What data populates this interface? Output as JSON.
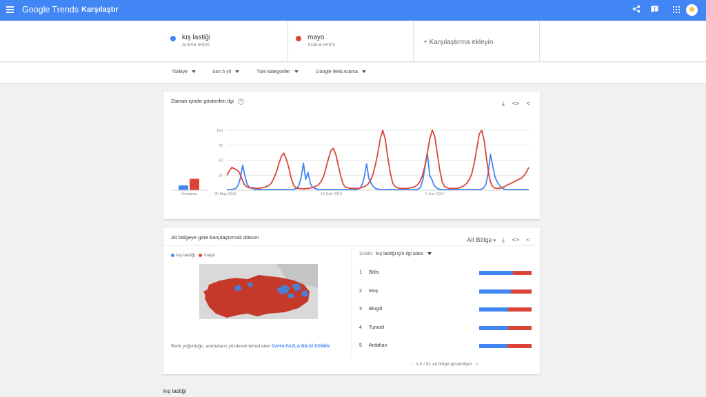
{
  "topbar": {
    "brand": "Google Trends",
    "page_name": "Karşılaştır",
    "icons": [
      "share-icon",
      "feedback-icon",
      "apps-icon",
      "avatar"
    ]
  },
  "terms": [
    {
      "name": "kış lastiği",
      "sub": "Arama terimi",
      "color": "#4285f4"
    },
    {
      "name": "mayo",
      "sub": "Arama terimi",
      "color": "#db4437"
    }
  ],
  "add_term_label": "+ Karşılaştırma ekleyin",
  "filters": [
    "Türkiye",
    "Son 5 yıl",
    "Tüm kategoriler",
    "Google Web Arama"
  ],
  "interest_card": {
    "title": "Zaman içinde gösterilen ilgi",
    "average_label": "Ortalama"
  },
  "chart_data": {
    "type": "line",
    "title": "",
    "y_ticks": [
      "100",
      "75",
      "50",
      "25"
    ],
    "ylim": [
      0,
      100
    ],
    "x_ticks": [
      "25 May 2014",
      "14 Şub 2016",
      "5 Kas 2017"
    ],
    "averages": [
      {
        "name": "kış lastiği",
        "value": 8
      },
      {
        "name": "mayo",
        "value": 19
      }
    ],
    "series": [
      {
        "name": "kış lastiği",
        "color": "#4285f4",
        "values": [
          1,
          1,
          1,
          2,
          3,
          8,
          20,
          42,
          25,
          10,
          5,
          3,
          2,
          1,
          1,
          1,
          1,
          1,
          1,
          1,
          1,
          1,
          1,
          1,
          1,
          1,
          1,
          1,
          1,
          1,
          2,
          3,
          8,
          22,
          45,
          18,
          30,
          12,
          5,
          3,
          2,
          1,
          1,
          1,
          1,
          1,
          1,
          1,
          1,
          1,
          1,
          1,
          1,
          1,
          1,
          1,
          1,
          1,
          2,
          3,
          9,
          22,
          44,
          20,
          12,
          6,
          3,
          2,
          1,
          1,
          1,
          1,
          1,
          1,
          1,
          1,
          1,
          1,
          1,
          1,
          1,
          1,
          1,
          1,
          1,
          2,
          5,
          18,
          40,
          62,
          25,
          18,
          8,
          4,
          2,
          1,
          1,
          1,
          1,
          1,
          1,
          1,
          1,
          1,
          1,
          1,
          1,
          1,
          1,
          1,
          1,
          1,
          1,
          2,
          4,
          10,
          30,
          60,
          40,
          22,
          14,
          8,
          4,
          2,
          1,
          1,
          1,
          1,
          1,
          1,
          1,
          1,
          1,
          1,
          1
        ]
      },
      {
        "name": "mayo",
        "color": "#db4437",
        "values": [
          25,
          32,
          38,
          36,
          34,
          30,
          20,
          10,
          6,
          4,
          4,
          4,
          3,
          3,
          4,
          5,
          6,
          8,
          12,
          20,
          30,
          44,
          56,
          62,
          52,
          38,
          20,
          8,
          4,
          3,
          3,
          2,
          3,
          3,
          4,
          5,
          7,
          9,
          14,
          22,
          36,
          52,
          66,
          70,
          60,
          42,
          24,
          10,
          5,
          4,
          3,
          3,
          3,
          3,
          4,
          5,
          7,
          10,
          16,
          26,
          42,
          62,
          86,
          100,
          85,
          55,
          30,
          12,
          6,
          4,
          3,
          3,
          3,
          3,
          4,
          5,
          6,
          9,
          14,
          24,
          40,
          62,
          86,
          100,
          90,
          62,
          34,
          14,
          6,
          4,
          3,
          3,
          3,
          3,
          4,
          6,
          8,
          12,
          18,
          28,
          46,
          70,
          94,
          100,
          82,
          50,
          22,
          8,
          4,
          3,
          3,
          4,
          6,
          8,
          10,
          12,
          14,
          16,
          18,
          20,
          24,
          30,
          38
        ]
      }
    ]
  },
  "region_card": {
    "title": "Alt bölgeye göre karşılaştırmalı döküm",
    "scope": "Alt Bölge",
    "legend": [
      "kış lastiği",
      "mayo"
    ],
    "note": "Renk yoğunluğu, aramaların yüzdesini temsil eder",
    "more_link": "DAHA FAZLA BİLGİ EDİNİN",
    "sort_label": "Sırala:",
    "sort_value": "kış lastiği için ilgi alanı",
    "regions": [
      {
        "rank": "1",
        "name": "Bitlis",
        "share": 0.65
      },
      {
        "rank": "2",
        "name": "Muş",
        "share": 0.6
      },
      {
        "rank": "3",
        "name": "Bingöl",
        "share": 0.55
      },
      {
        "rank": "4",
        "name": "Tunceli",
        "share": 0.55
      },
      {
        "rank": "5",
        "name": "Ardahan",
        "share": 0.54
      }
    ],
    "pager": "1-5 / 81 alt bölge gösteriliyor"
  },
  "bottom_label": "kış lastiği"
}
